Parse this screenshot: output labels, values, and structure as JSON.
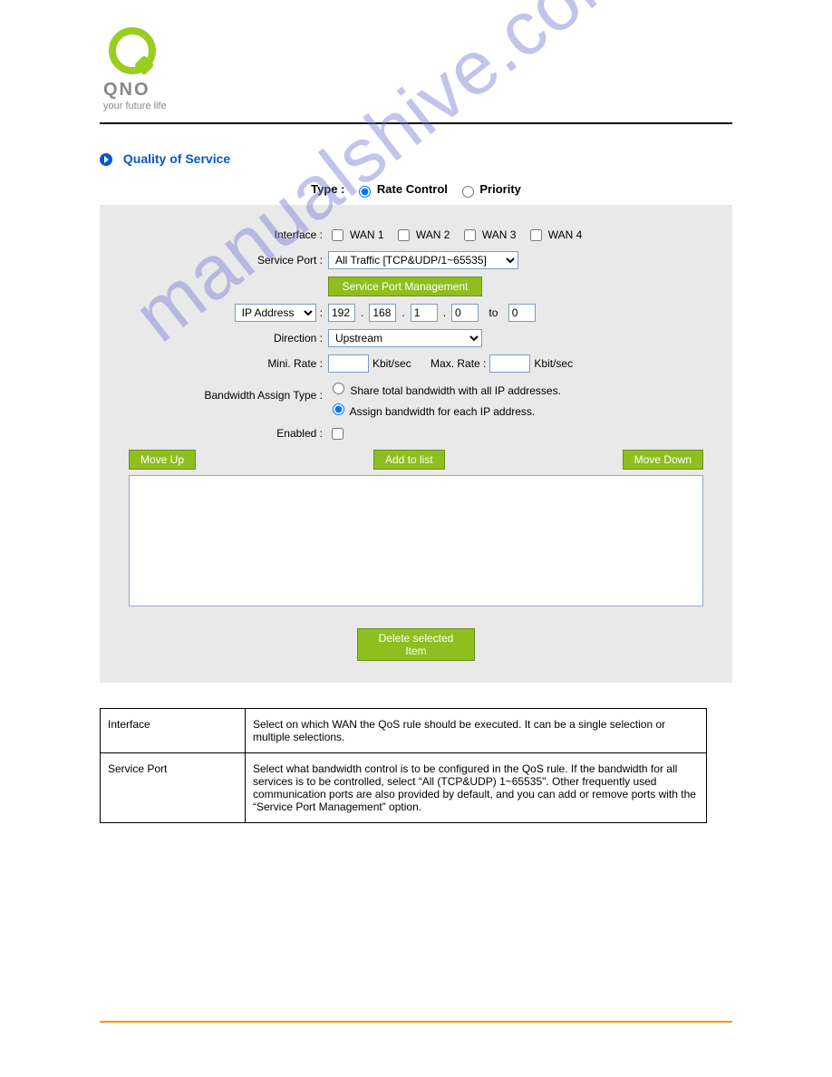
{
  "logo": {
    "brand": "QNO",
    "tagline": "your future life"
  },
  "section_title": "Quality of Service",
  "type": {
    "label": "Type :",
    "options": {
      "rate_control": "Rate Control",
      "priority": "Priority"
    },
    "selected": "rate_control"
  },
  "form": {
    "interface": {
      "label": "Interface :",
      "wans": [
        "WAN 1",
        "WAN 2",
        "WAN 3",
        "WAN 4"
      ]
    },
    "service_port": {
      "label": "Service Port :",
      "value": "All Traffic [TCP&UDP/1~65535]",
      "manage_btn": "Service Port Management"
    },
    "ip": {
      "selector": "IP Address",
      "oct": [
        "192",
        "168",
        "1",
        "0"
      ],
      "to_label": "to",
      "to_value": "0"
    },
    "direction": {
      "label": "Direction :",
      "value": "Upstream"
    },
    "rate": {
      "min_label": "Mini. Rate :",
      "min_val": "",
      "unit": "Kbit/sec",
      "max_label": "Max. Rate :",
      "max_val": ""
    },
    "assign": {
      "label": "Bandwidth Assign Type :",
      "share": "Share total bandwidth with all IP addresses.",
      "each": "Assign bandwidth for each IP address.",
      "selected": "each"
    },
    "enabled_label": "Enabled :",
    "buttons": {
      "move_up": "Move Up",
      "add": "Add to list",
      "move_down": "Move Down",
      "delete": "Delete selected Item"
    }
  },
  "table": {
    "r1c1": "Interface",
    "r1c2": "Select on which WAN the QoS rule should be executed. It can be a single selection or multiple selections.",
    "r2c1": "Service Port",
    "r2c2": "Select what bandwidth control is to be configured in the QoS rule. If the bandwidth for all services is to be controlled, select “All (TCP&UDP) 1~65535\". Other frequently used communication ports are also provided by default, and you can add or remove ports with the “Service Port Management” option."
  },
  "watermark": "manualshive.com"
}
